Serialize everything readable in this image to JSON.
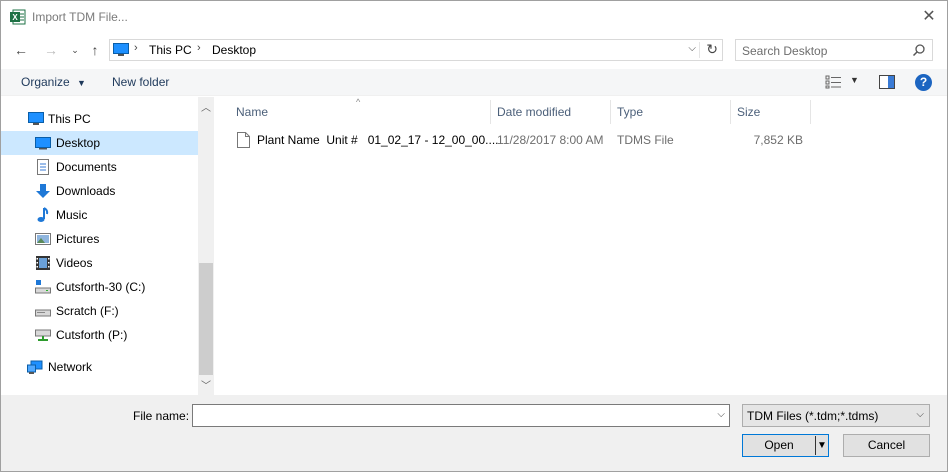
{
  "window": {
    "title": "Import TDM File..."
  },
  "address": {
    "crumbs": [
      "This PC",
      "Desktop"
    ]
  },
  "search": {
    "placeholder": "Search Desktop"
  },
  "toolbar": {
    "organize": "Organize",
    "new_folder": "New folder",
    "help": "?"
  },
  "nav": {
    "items": [
      {
        "label": "This PC",
        "icon": "computer-icon"
      },
      {
        "label": "Desktop",
        "icon": "desktop-icon",
        "selected": true
      },
      {
        "label": "Documents",
        "icon": "documents-icon"
      },
      {
        "label": "Downloads",
        "icon": "downloads-icon"
      },
      {
        "label": "Music",
        "icon": "music-icon"
      },
      {
        "label": "Pictures",
        "icon": "pictures-icon"
      },
      {
        "label": "Videos",
        "icon": "videos-icon"
      },
      {
        "label": "Cutsforth-30 (C:)",
        "icon": "drive-icon"
      },
      {
        "label": "Scratch (F:)",
        "icon": "drive-icon"
      },
      {
        "label": "Cutsforth (P:)",
        "icon": "network-drive-icon"
      },
      {
        "label": "Network",
        "icon": "network-icon"
      }
    ]
  },
  "columns": {
    "name": "Name",
    "date": "Date modified",
    "type": "Type",
    "size": "Size"
  },
  "files": [
    {
      "name": "Plant Name  Unit #   01_02_17 - 12_00_00....",
      "date": "11/28/2017 8:00 AM",
      "type": "TDMS File",
      "size": "7,852 KB"
    }
  ],
  "bottom": {
    "file_name_label": "File name:",
    "file_name_value": "",
    "filter": "TDM Files (*.tdm;*.tdms)",
    "open": "Open",
    "cancel": "Cancel"
  },
  "colors": {
    "accent": "#0078d7",
    "selection": "#cce8ff",
    "link": "#1e395b"
  }
}
